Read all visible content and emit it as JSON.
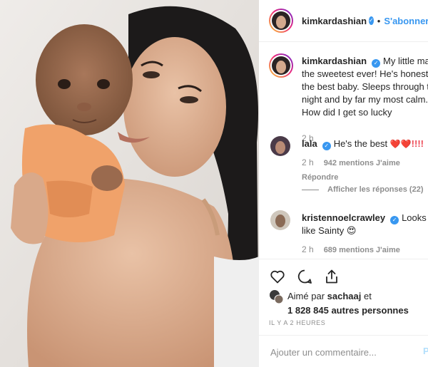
{
  "post": {
    "username": "kimkardashian",
    "follow_label": "S'abonner",
    "dot": "•"
  },
  "caption": {
    "username": "kimkardashian",
    "text": "My little man is the sweetest ever! He's honestly the best baby. Sleeps through the night and by far my most calm. How did I get so lucky",
    "time": "2 h"
  },
  "comments": [
    {
      "username": "lala",
      "text": "He's the best",
      "emoji": "❤️❤️",
      "bangs": "!!!!",
      "time": "2 h",
      "likes": "942 mentions J'aime",
      "reply": "Répondre"
    },
    {
      "username": "kristennoelcrawley",
      "text": "Looks just like Sainty",
      "emoji": "😍",
      "time": "2 h",
      "likes": "689 mentions J'aime"
    }
  ],
  "view_replies": "Afficher les réponses (22)",
  "likes": {
    "line1_prefix": "Aimé par",
    "line1_user": "sachaaj",
    "line1_suffix": "et",
    "line2": "1 828 845 autres personnes"
  },
  "timestamp": "IL Y A 2 HEURES",
  "add_comment": {
    "placeholder": "Ajouter un commentaire...",
    "post_label": "P"
  },
  "colors": {
    "accent": "#3897f0",
    "heart": "#ed4956",
    "muted": "#8e8e8e"
  },
  "icons": [
    "heart-icon",
    "comment-icon",
    "share-icon",
    "verified-badge-icon"
  ]
}
